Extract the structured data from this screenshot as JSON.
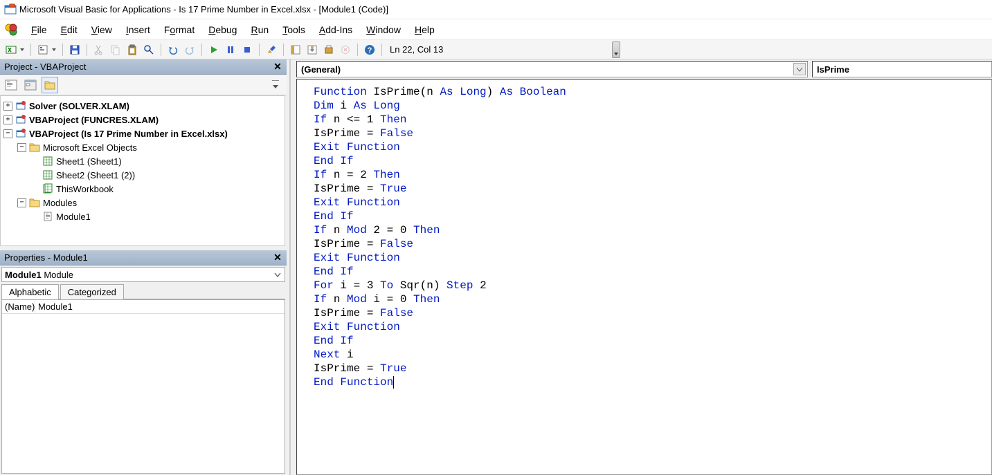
{
  "title": "Microsoft Visual Basic for Applications - Is 17 Prime Number in Excel.xlsx - [Module1 (Code)]",
  "menu": {
    "file": "File",
    "edit": "Edit",
    "view": "View",
    "insert": "Insert",
    "format": "Format",
    "debug": "Debug",
    "run": "Run",
    "tools": "Tools",
    "addins": "Add-Ins",
    "window": "Window",
    "help": "Help"
  },
  "toolbar": {
    "position": "Ln 22, Col 13"
  },
  "project": {
    "title": "Project - VBAProject",
    "nodes": {
      "solver": "Solver (SOLVER.XLAM)",
      "funcres": "VBAProject (FUNCRES.XLAM)",
      "vba": "VBAProject (Is 17 Prime Number in Excel.xlsx)",
      "mseo": "Microsoft Excel Objects",
      "sheet1": "Sheet1 (Sheet1)",
      "sheet2": "Sheet2 (Sheet1 (2))",
      "twb": "ThisWorkbook",
      "modules": "Modules",
      "module1": "Module1"
    }
  },
  "properties": {
    "title": "Properties - Module1",
    "combo_bold": "Module1",
    "combo_rest": " Module",
    "tabs": {
      "alpha": "Alphabetic",
      "cat": "Categorized"
    },
    "name_key": "(Name)",
    "name_val": "Module1"
  },
  "code": {
    "object": "(General)",
    "proc": "IsPrime",
    "lines": [
      [
        {
          "t": "Function ",
          "k": 1
        },
        {
          "t": "IsPrime(n "
        },
        {
          "t": "As Long",
          "k": 1
        },
        {
          "t": ") "
        },
        {
          "t": "As Boolean",
          "k": 1
        }
      ],
      [
        {
          "t": "Dim ",
          "k": 1
        },
        {
          "t": "i "
        },
        {
          "t": "As Long",
          "k": 1
        }
      ],
      [
        {
          "t": "If ",
          "k": 1
        },
        {
          "t": "n <= 1 "
        },
        {
          "t": "Then",
          "k": 1
        }
      ],
      [
        {
          "t": "IsPrime = "
        },
        {
          "t": "False",
          "k": 1
        }
      ],
      [
        {
          "t": "Exit Function",
          "k": 1
        }
      ],
      [
        {
          "t": "End If",
          "k": 1
        }
      ],
      [
        {
          "t": "If ",
          "k": 1
        },
        {
          "t": "n = 2 "
        },
        {
          "t": "Then",
          "k": 1
        }
      ],
      [
        {
          "t": "IsPrime = "
        },
        {
          "t": "True",
          "k": 1
        }
      ],
      [
        {
          "t": "Exit Function",
          "k": 1
        }
      ],
      [
        {
          "t": "End If",
          "k": 1
        }
      ],
      [
        {
          "t": "If ",
          "k": 1
        },
        {
          "t": "n "
        },
        {
          "t": "Mod ",
          "k": 1
        },
        {
          "t": "2 = 0 "
        },
        {
          "t": "Then",
          "k": 1
        }
      ],
      [
        {
          "t": "IsPrime = "
        },
        {
          "t": "False",
          "k": 1
        }
      ],
      [
        {
          "t": "Exit Function",
          "k": 1
        }
      ],
      [
        {
          "t": "End If",
          "k": 1
        }
      ],
      [
        {
          "t": "For ",
          "k": 1
        },
        {
          "t": "i = 3 "
        },
        {
          "t": "To ",
          "k": 1
        },
        {
          "t": "Sqr(n) "
        },
        {
          "t": "Step ",
          "k": 1
        },
        {
          "t": "2"
        }
      ],
      [
        {
          "t": "If ",
          "k": 1
        },
        {
          "t": "n "
        },
        {
          "t": "Mod ",
          "k": 1
        },
        {
          "t": "i = 0 "
        },
        {
          "t": "Then",
          "k": 1
        }
      ],
      [
        {
          "t": "IsPrime = "
        },
        {
          "t": "False",
          "k": 1
        }
      ],
      [
        {
          "t": "Exit Function",
          "k": 1
        }
      ],
      [
        {
          "t": "End If",
          "k": 1
        }
      ],
      [
        {
          "t": "Next ",
          "k": 1
        },
        {
          "t": "i"
        }
      ],
      [
        {
          "t": "IsPrime = "
        },
        {
          "t": "True",
          "k": 1
        }
      ],
      [
        {
          "t": "End Function",
          "k": 1
        }
      ]
    ]
  }
}
